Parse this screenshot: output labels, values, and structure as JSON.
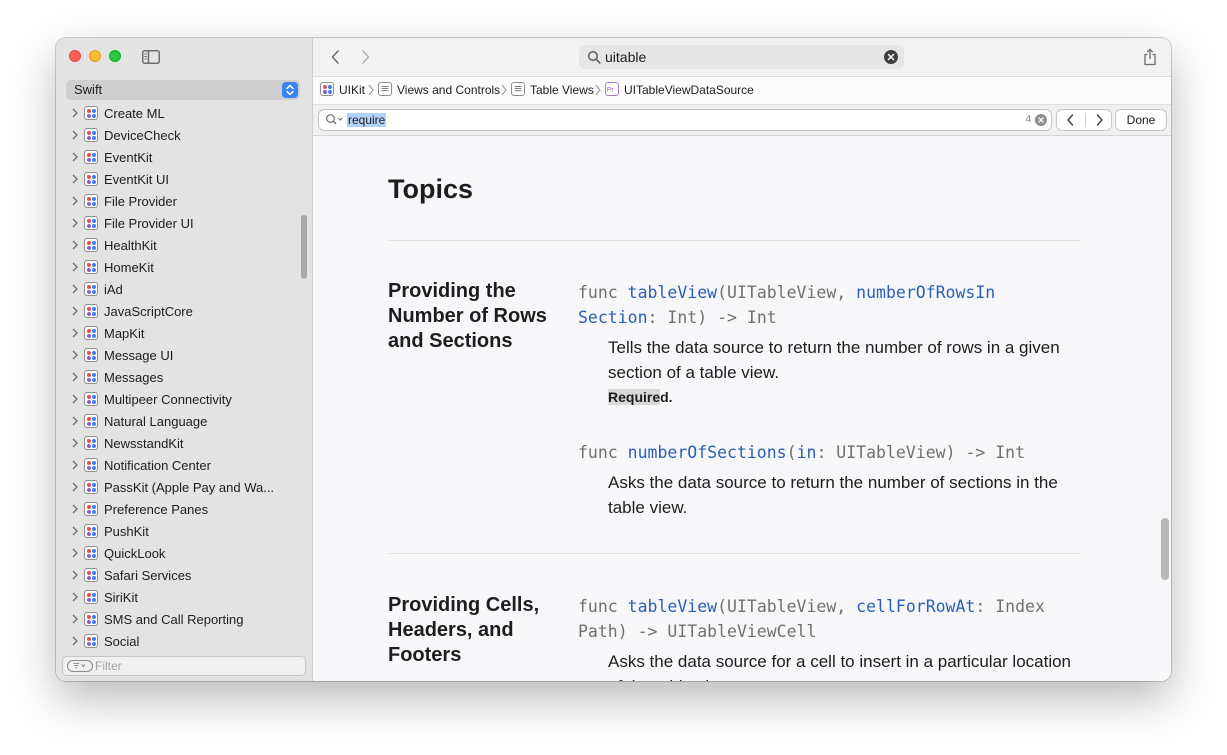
{
  "sidebar": {
    "language": "Swift",
    "filter_placeholder": "Filter",
    "items": [
      {
        "label": "Create ML"
      },
      {
        "label": "DeviceCheck"
      },
      {
        "label": "EventKit"
      },
      {
        "label": "EventKit UI"
      },
      {
        "label": "File Provider"
      },
      {
        "label": "File Provider UI"
      },
      {
        "label": "HealthKit"
      },
      {
        "label": "HomeKit"
      },
      {
        "label": "iAd"
      },
      {
        "label": "JavaScriptCore"
      },
      {
        "label": "MapKit"
      },
      {
        "label": "Message UI"
      },
      {
        "label": "Messages"
      },
      {
        "label": "Multipeer Connectivity"
      },
      {
        "label": "Natural Language"
      },
      {
        "label": "NewsstandKit"
      },
      {
        "label": "Notification Center"
      },
      {
        "label": "PassKit (Apple Pay and Wa..."
      },
      {
        "label": "Preference Panes"
      },
      {
        "label": "PushKit"
      },
      {
        "label": "QuickLook"
      },
      {
        "label": "Safari Services"
      },
      {
        "label": "SiriKit"
      },
      {
        "label": "SMS and Call Reporting"
      },
      {
        "label": "Social"
      }
    ]
  },
  "toolbar": {
    "search_value": "uitable"
  },
  "breadcrumb": [
    "UIKit",
    "Views and Controls",
    "Table Views",
    "UITableViewDataSource"
  ],
  "find": {
    "query": "require",
    "count": "4",
    "done_label": "Done"
  },
  "content": {
    "heading": "Topics",
    "sections": [
      {
        "title": "Providing the Number of Rows and Sections",
        "entries": [
          {
            "code1_kw": "func ",
            "code1_fn": "tableView",
            "code1_a": "(UITableView, ",
            "code1_b": "numberOfRowsIn",
            "code2_b": "Section",
            "code2_rest": ": Int) -> Int",
            "desc": "Tells the data source to return the number of rows in a given section of a table view.",
            "req_hl": "Require",
            "req_rest": "d."
          },
          {
            "code1_kw": "func ",
            "code1_fn": "numberOfSections",
            "code1_a": "(",
            "code1_b": "in",
            "code1_rest": ": UITableView) -> Int",
            "desc": "Asks the data source to return the number of sections in the table view."
          }
        ]
      },
      {
        "title": "Providing Cells, Headers, and Footers",
        "entries": [
          {
            "code1_kw": "func ",
            "code1_fn": "tableView",
            "code1_a": "(UITableView, ",
            "code1_b": "cellForRowAt",
            "code1_rest": ": Index",
            "code2_rest": "Path) -> UITableViewCell",
            "desc": "Asks the data source for a cell to insert in a particular location of the table view."
          }
        ]
      }
    ]
  }
}
